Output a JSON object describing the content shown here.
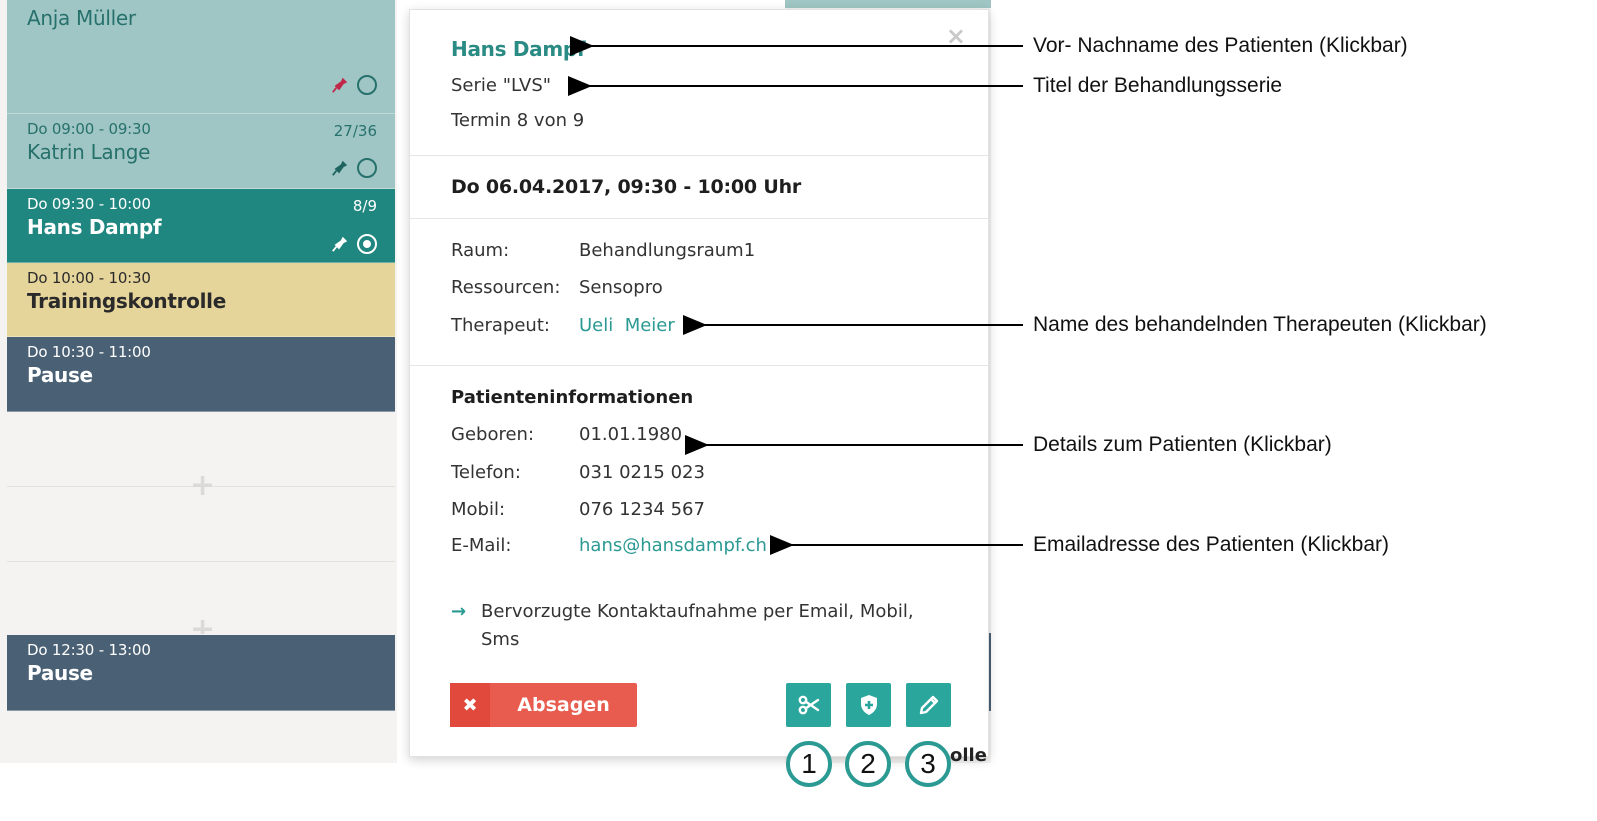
{
  "calendar": {
    "appointments": [
      {
        "time": "",
        "count": "",
        "name": "Anja Müller"
      },
      {
        "time": "Do 09:00 - 09:30",
        "count": "27/36",
        "name": "Katrin Lange"
      },
      {
        "time": "Do 09:30 - 10:00",
        "count": "8/9",
        "name": "Hans Dampf"
      },
      {
        "time": "Do 10:00 - 10:30",
        "count": "",
        "name": "Trainingskontrolle"
      },
      {
        "time": "Do 10:30 - 11:00",
        "count": "",
        "name": "Pause"
      },
      {
        "time": "Do 12:30 - 13:00",
        "count": "",
        "name": "Pause"
      }
    ],
    "add_symbol": "+",
    "colors": {
      "light": "#9fc6c4",
      "active": "#208680",
      "training": "#e6d59b",
      "pause": "#4a6175",
      "pin_red": "#c0284a"
    }
  },
  "popup": {
    "close_symbol": "×",
    "patient_name": "Hans Dampf",
    "series": "Serie \"LVS\"",
    "appointment_of": "Termin 8 von 9",
    "datetime": "Do 06.04.2017, 09:30 - 10:00 Uhr",
    "details": [
      {
        "label": "Raum:",
        "value": "Behandlungsraum1"
      },
      {
        "label": "Ressourcen:",
        "value": "Sensopro"
      },
      {
        "label": "Therapeut:",
        "value": "Ueli  Meier"
      }
    ],
    "patient_info_heading": "Patienteninformationen",
    "patient_info": [
      {
        "label": "Geboren:",
        "value": "01.01.1980"
      },
      {
        "label": "Telefon:",
        "value": "031 0215 023"
      },
      {
        "label": "Mobil:",
        "value": "076 1234 567"
      },
      {
        "label": "E-Mail:",
        "value": "hans@hansdampf.ch"
      }
    ],
    "contact_note": "Bervorzugte Kontaktaufnahme per Email, Mobil, Sms",
    "cancel_icon": "✖",
    "cancel_label": "Absagen",
    "action_icons": [
      "scissors-icon",
      "shield-plus-icon",
      "pencil-icon"
    ],
    "accent": "#2aa69c",
    "cancel_color": "#e85c4f"
  },
  "callouts": [
    "1",
    "2",
    "3"
  ],
  "peek_text": "olle",
  "annotations": {
    "name": "Vor- Nachname des Patienten (Klickbar)",
    "series": "Titel der Behandlungsserie",
    "therapist": "Name des behandelnden Therapeuten (Klickbar)",
    "details": "Details zum Patienten (Klickbar)",
    "email": "Emailadresse des Patienten (Klickbar)"
  }
}
